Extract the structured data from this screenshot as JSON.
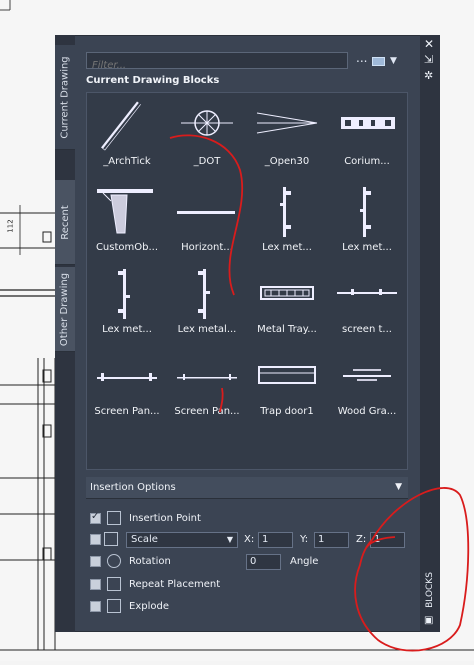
{
  "tabs": [
    {
      "label": "Current Drawing",
      "active": true
    },
    {
      "label": "Recent",
      "active": false
    },
    {
      "label": "Other Drawing",
      "active": false
    }
  ],
  "search": {
    "placeholder": "Filter..."
  },
  "toolbar": {
    "more": "...",
    "view_icon": "thumbnail-view-icon"
  },
  "section_title": "Current Drawing Blocks",
  "blocks": [
    {
      "label": "_ArchTick",
      "icon": "archtick-icon"
    },
    {
      "label": "_DOT",
      "icon": "dot-icon"
    },
    {
      "label": "_Open30",
      "icon": "open30-icon"
    },
    {
      "label": "Corium...",
      "icon": "corium-icon"
    },
    {
      "label": "CustomOb...",
      "icon": "customob-icon"
    },
    {
      "label": "Horizont...",
      "icon": "horizontal-icon"
    },
    {
      "label": "Lex met...",
      "icon": "lex-metal-icon"
    },
    {
      "label": "Lex met...",
      "icon": "lex-metal-icon"
    },
    {
      "label": "Lex met...",
      "icon": "lex-metal-icon"
    },
    {
      "label": "Lex metal...",
      "icon": "lex-metal-icon"
    },
    {
      "label": "Metal Tray...",
      "icon": "metal-tray-icon"
    },
    {
      "label": "screen  t...",
      "icon": "screen-t-icon"
    },
    {
      "label": "Screen Pan...",
      "icon": "screen-panel-icon"
    },
    {
      "label": "Screen Pan...",
      "icon": "screen-panel-icon"
    },
    {
      "label": "Trap door1",
      "icon": "trap-door-icon"
    },
    {
      "label": "Wood Gra...",
      "icon": "wood-grain-icon"
    }
  ],
  "insertion_options": {
    "title": "Insertion Options",
    "insertion_point": {
      "label": "Insertion Point",
      "checked": true
    },
    "scale": {
      "selected": "Scale",
      "checked": false
    },
    "x_label": "X:",
    "x_value": "1",
    "y_label": "Y:",
    "y_value": "1",
    "z_label": "Z:",
    "z_value": "1",
    "rotation": {
      "label": "Rotation",
      "checked": false,
      "value": "0",
      "angle_label": "Angle"
    },
    "repeat_placement": {
      "label": "Repeat Placement",
      "checked": false
    },
    "explode": {
      "label": "Explode",
      "checked": false
    }
  },
  "palette_title": "BLOCKS",
  "drawing_dimension": "112",
  "colors": {
    "panel": "#3b4453",
    "annotation": "#d91c1c"
  }
}
